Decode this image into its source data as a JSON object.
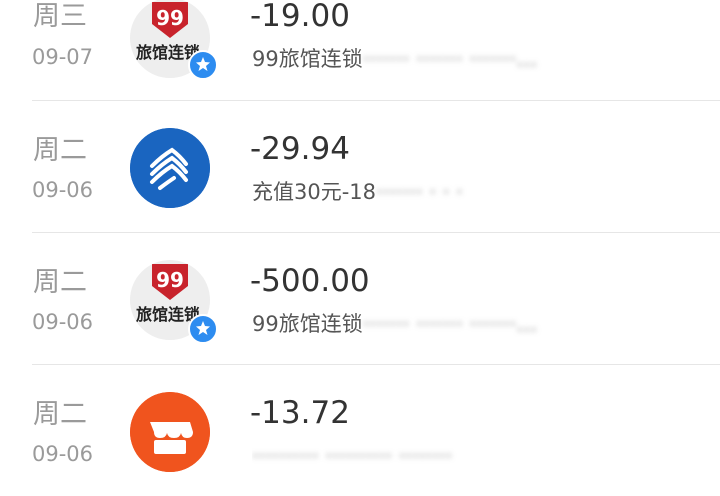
{
  "transactions": [
    {
      "day": "周三",
      "date": "09-07",
      "amount": "-19.00",
      "description": "99旅馆连锁",
      "description_obscured": "·······  ·······  ·······…",
      "merchant_icon": "hotel-99-logo",
      "logo_text": "99",
      "logo_caption": "旅馆连锁",
      "verified": true
    },
    {
      "day": "周二",
      "date": "09-06",
      "amount": "-29.94",
      "description": "充值30元-18",
      "description_obscured": "·······  ·  ·  ·",
      "merchant_icon": "china-mobile-icon",
      "verified": false
    },
    {
      "day": "周二",
      "date": "09-06",
      "amount": "-500.00",
      "description": "99旅馆连锁",
      "description_obscured": "·······  ·······  ·······…",
      "merchant_icon": "hotel-99-logo",
      "logo_text": "99",
      "logo_caption": "旅馆连锁",
      "verified": true
    },
    {
      "day": "周二",
      "date": "09-06",
      "amount": "-13.72",
      "description": "",
      "description_obscured": "··········  ··········  ········",
      "merchant_icon": "store-icon",
      "verified": false
    }
  ],
  "colors": {
    "hotel_red": "#c8232c",
    "mobile_blue": "#1a65c0",
    "store_orange": "#f0541e",
    "verified_blue": "#2d8cf0",
    "text_gray": "#9a9a9a"
  }
}
